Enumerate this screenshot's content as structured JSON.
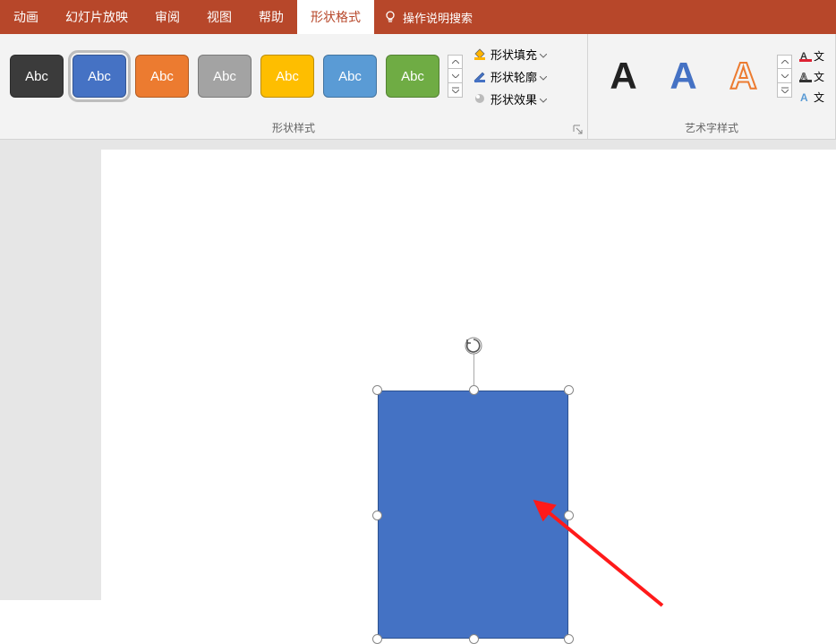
{
  "tabs": {
    "animation": "动画",
    "slideshow": "幻灯片放映",
    "review": "审阅",
    "view": "视图",
    "help": "帮助",
    "shape_format": "形状格式",
    "tell_me": "操作说明搜索"
  },
  "ribbon": {
    "shape_styles": {
      "label": "形状样式",
      "swatch_text": "Abc",
      "fill": "形状填充",
      "outline": "形状轮廓",
      "effects": "形状效果"
    },
    "wordart_styles": {
      "label": "艺术字样式",
      "glyph": "A",
      "text_fill_short": "文",
      "text_outline_short": "文",
      "text_effects_short": "文"
    }
  },
  "colors": {
    "ribbon_bg": "#b7472a",
    "shape_fill": "#4472c4"
  }
}
